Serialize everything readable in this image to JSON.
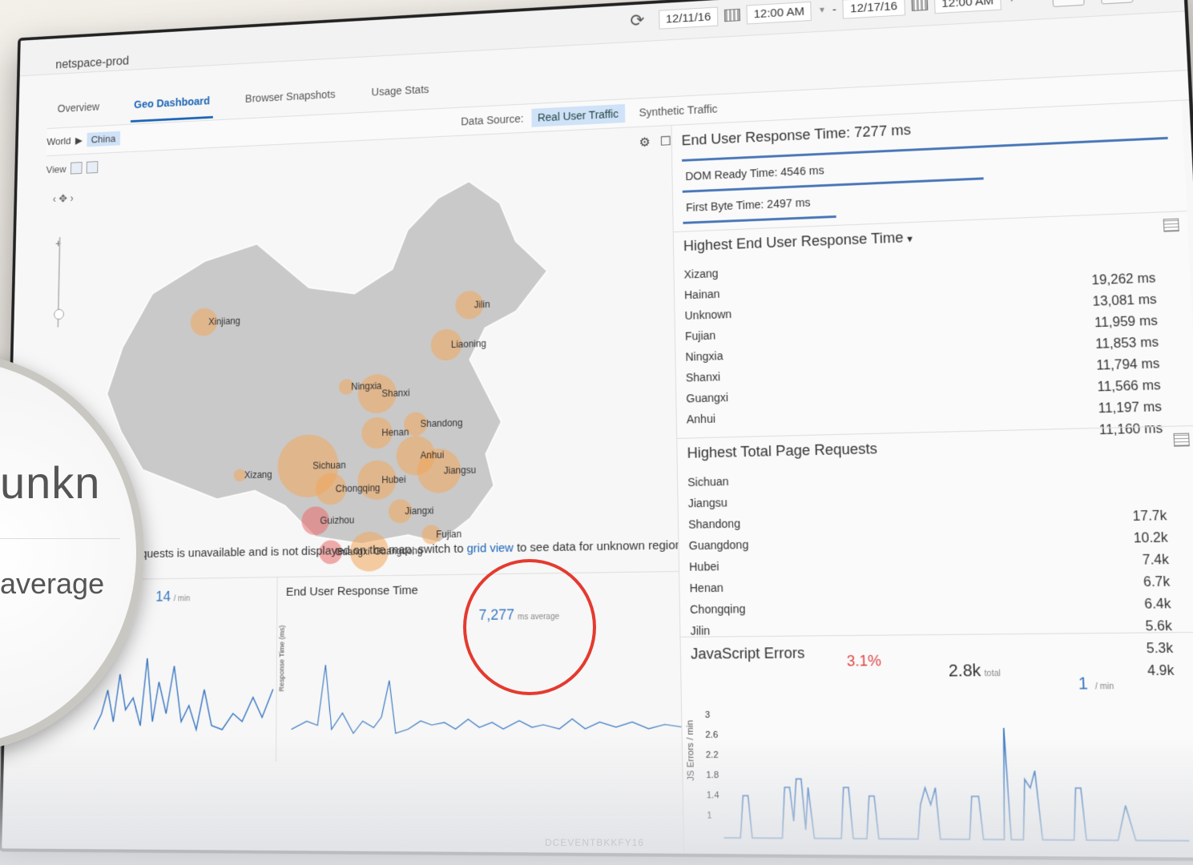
{
  "app": {
    "title": "netspace-prod"
  },
  "daterange": {
    "start_date": "12/11/16",
    "start_time": "12:00 AM",
    "separator": "-",
    "end_date": "12/17/16",
    "end_time": "12:00 AM"
  },
  "tabs": [
    {
      "label": "Overview"
    },
    {
      "label": "Geo Dashboard",
      "active": true
    },
    {
      "label": "Browser Snapshots"
    },
    {
      "label": "Usage Stats"
    }
  ],
  "breadcrumb": {
    "root": "World",
    "current": "China"
  },
  "datasource": {
    "label": "Data Source:",
    "options": [
      "Real User Traffic",
      "Synthetic Traffic"
    ],
    "selected": "Real User Traffic"
  },
  "view": {
    "label": "View"
  },
  "map": {
    "regions": [
      "Xinjiang",
      "Jilin",
      "Liaoning",
      "Ningxia",
      "Shanxi",
      "Shandong",
      "Henan",
      "Xizang",
      "Sichuan",
      "Chongqing",
      "Hubei",
      "Anhui",
      "Jiangsu",
      "Jiangxi",
      "Guizhou",
      "Fujian",
      "Guangxi",
      "Guangdong",
      "Hainan"
    ],
    "notice_prefix": "Requests is unavailable and is not displayed on the map; switch to",
    "notice_link": "grid view",
    "notice_suffix": "to see data for unknown regions."
  },
  "mini_charts": {
    "requests": {
      "stat": "14",
      "unit": "/ min"
    },
    "response": {
      "title": "End User Response Time",
      "stat": "7,277",
      "unit": "ms average",
      "ylabel": "Response Time (ms)"
    }
  },
  "right": {
    "end_user": "End User Response Time: 7277 ms",
    "dom_ready": "DOM Ready Time: 4546 ms",
    "first_byte": "First Byte Time: 2497 ms",
    "highest_title": "Highest End User Response Time",
    "highest": [
      {
        "name": "Xizang",
        "value": ""
      },
      {
        "name": "Hainan",
        "value": "19,262 ms"
      },
      {
        "name": "Unknown",
        "value": "13,081 ms"
      },
      {
        "name": "Fujian",
        "value": "11,959 ms"
      },
      {
        "name": "Ningxia",
        "value": "11,853 ms"
      },
      {
        "name": "Shanxi",
        "value": "11,794 ms"
      },
      {
        "name": "Guangxi",
        "value": "11,566 ms"
      },
      {
        "name": "Anhui",
        "value": "11,197 ms"
      },
      {
        "name": "",
        "value": "11,160 ms"
      }
    ],
    "requests_title": "Highest Total Page Requests",
    "requests": [
      {
        "name": "Sichuan",
        "value": ""
      },
      {
        "name": "Jiangsu",
        "value": ""
      },
      {
        "name": "Shandong",
        "value": "17.7k"
      },
      {
        "name": "Guangdong",
        "value": "10.2k"
      },
      {
        "name": "Hubei",
        "value": "7.4k"
      },
      {
        "name": "Henan",
        "value": "6.7k"
      },
      {
        "name": "Chongqing",
        "value": "6.4k"
      },
      {
        "name": "Jilin",
        "value": "5.6k"
      },
      {
        "name": "",
        "value": "5.3k"
      },
      {
        "name": "",
        "value": "4.9k"
      }
    ],
    "js": {
      "title": "JavaScript Errors",
      "percent": "3.1%",
      "total": "2.8k",
      "total_unit": "total",
      "rate": "1",
      "rate_unit": "/ min",
      "ylabel": "JS Errors / min",
      "ticks": [
        "3",
        "2.6",
        "2.2",
        "1.8",
        "1.4",
        "1"
      ]
    }
  },
  "magnifier": {
    "line1": "unkn",
    "line2": "average"
  },
  "watermark": "DCEVENTBKKFY16",
  "colors": {
    "accent": "#1b64b5",
    "bar": "#4876b8",
    "alert": "#e04646",
    "bubble": "#f2a55a",
    "bubble_red": "#e96a6a"
  }
}
